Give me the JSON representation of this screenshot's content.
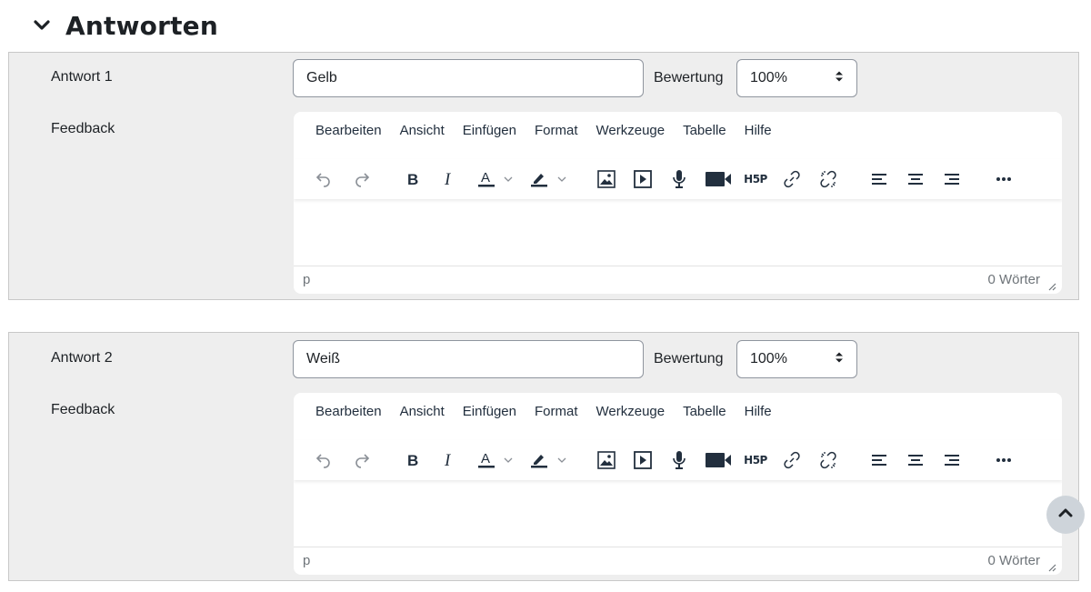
{
  "section": {
    "title": "Antworten",
    "icon": "chevron-down-icon"
  },
  "answers": [
    {
      "label": "Antwort 1",
      "value": "Gelb",
      "grade_label": "Bewertung",
      "grade_value": "100%",
      "feedback_label": "Feedback",
      "status_path": "p",
      "word_count": "0 Wörter"
    },
    {
      "label": "Antwort 2",
      "value": "Weiß",
      "grade_label": "Bewertung",
      "grade_value": "100%",
      "feedback_label": "Feedback",
      "status_path": "p",
      "word_count": "0 Wörter"
    }
  ],
  "editor_menu": [
    "Bearbeiten",
    "Ansicht",
    "Einfügen",
    "Format",
    "Werkzeuge",
    "Tabelle",
    "Hilfe"
  ],
  "editor_toolbar_icons": [
    "undo-icon",
    "redo-icon",
    "bold-icon",
    "italic-icon",
    "text-color-icon",
    "highlight-icon",
    "image-icon",
    "media-icon",
    "microphone-icon",
    "video-camera-icon",
    "h5p-icon",
    "link-icon",
    "unlink-icon",
    "align-left-icon",
    "align-center-icon",
    "align-right-icon",
    "more-icon"
  ],
  "h5p_text": "H5P",
  "scroll_top_icon": "chevron-up-icon"
}
